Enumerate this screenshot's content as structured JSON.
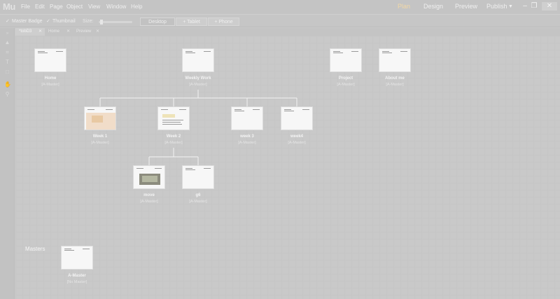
{
  "app": {
    "logo": "Mu"
  },
  "menu": [
    "File",
    "Edit",
    "Page",
    "Object",
    "View",
    "Window",
    "Help"
  ],
  "modes": {
    "plan": "Plan",
    "design": "Design",
    "preview": "Preview",
    "publish": "Publish"
  },
  "options": {
    "master_badge": "Master Badge",
    "thumbnail": "Thumbnail",
    "size_label": "Size:",
    "size_level": 0.1,
    "layouts": [
      "Desktop",
      "+ Tablet",
      "+ Phone"
    ]
  },
  "tabs": [
    {
      "label": "*tobD3",
      "active": true
    },
    {
      "label": "Home"
    },
    {
      "label": "Preview"
    }
  ],
  "pages": {
    "home": {
      "name": "Home",
      "master": "[A-Master]"
    },
    "weekly": {
      "name": "Weekly Work",
      "master": "[A-Master]"
    },
    "project": {
      "name": "Project",
      "master": "[A-Master]"
    },
    "about": {
      "name": "About me",
      "master": "[A-Master]"
    },
    "week1": {
      "name": "Week 1",
      "master": "[A-Master]"
    },
    "week2": {
      "name": "Week 2",
      "master": "[A-Master]"
    },
    "week3": {
      "name": "week 3",
      "master": "[A-Master]"
    },
    "week4": {
      "name": "week4",
      "master": "[A-Master]"
    },
    "move": {
      "name": "move",
      "master": "[A-Master]"
    },
    "g6": {
      "name": "g6",
      "master": "[A-Master]"
    }
  },
  "masters": {
    "label": "Masters",
    "amaster": {
      "name": "A-Master",
      "master": "[No Master]"
    }
  },
  "colors": {
    "active_mode": "#f2d8a6",
    "canvas": "#c9c9c9",
    "connector": "#f2f2f2"
  }
}
